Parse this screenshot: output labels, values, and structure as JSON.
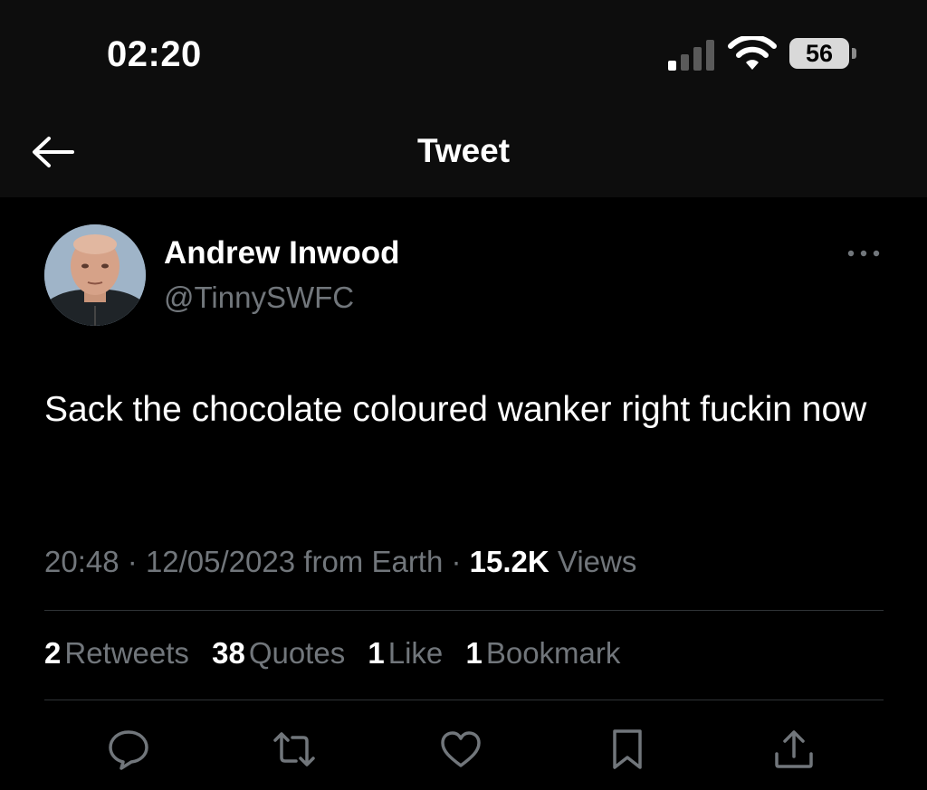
{
  "status_bar": {
    "time": "02:20",
    "battery": "56",
    "icons": [
      "signal-icon",
      "wifi-icon",
      "battery-icon"
    ]
  },
  "header": {
    "title": "Tweet",
    "back_icon": "arrow-left-icon"
  },
  "tweet": {
    "author": {
      "display_name": "Andrew Inwood",
      "handle": "@TinnySWFC"
    },
    "more_icon": "more-horizontal-icon",
    "text": "Sack the chocolate coloured wanker right fuckin now",
    "time": "20:48",
    "date": "12/05/2023",
    "source": "from Earth",
    "views_count": "15.2K",
    "views_label": "Views",
    "separator": "·"
  },
  "stats": [
    {
      "count": "2",
      "label": "Retweets"
    },
    {
      "count": "38",
      "label": "Quotes"
    },
    {
      "count": "1",
      "label": "Like"
    },
    {
      "count": "1",
      "label": "Bookmark"
    }
  ],
  "actions": [
    "reply-icon",
    "retweet-icon",
    "like-icon",
    "bookmark-icon",
    "share-icon"
  ],
  "colors": {
    "background": "#000000",
    "bar_background": "#0d0d0d",
    "primary_text": "#ffffff",
    "secondary_text": "#71767b",
    "divider": "#2f3336"
  }
}
